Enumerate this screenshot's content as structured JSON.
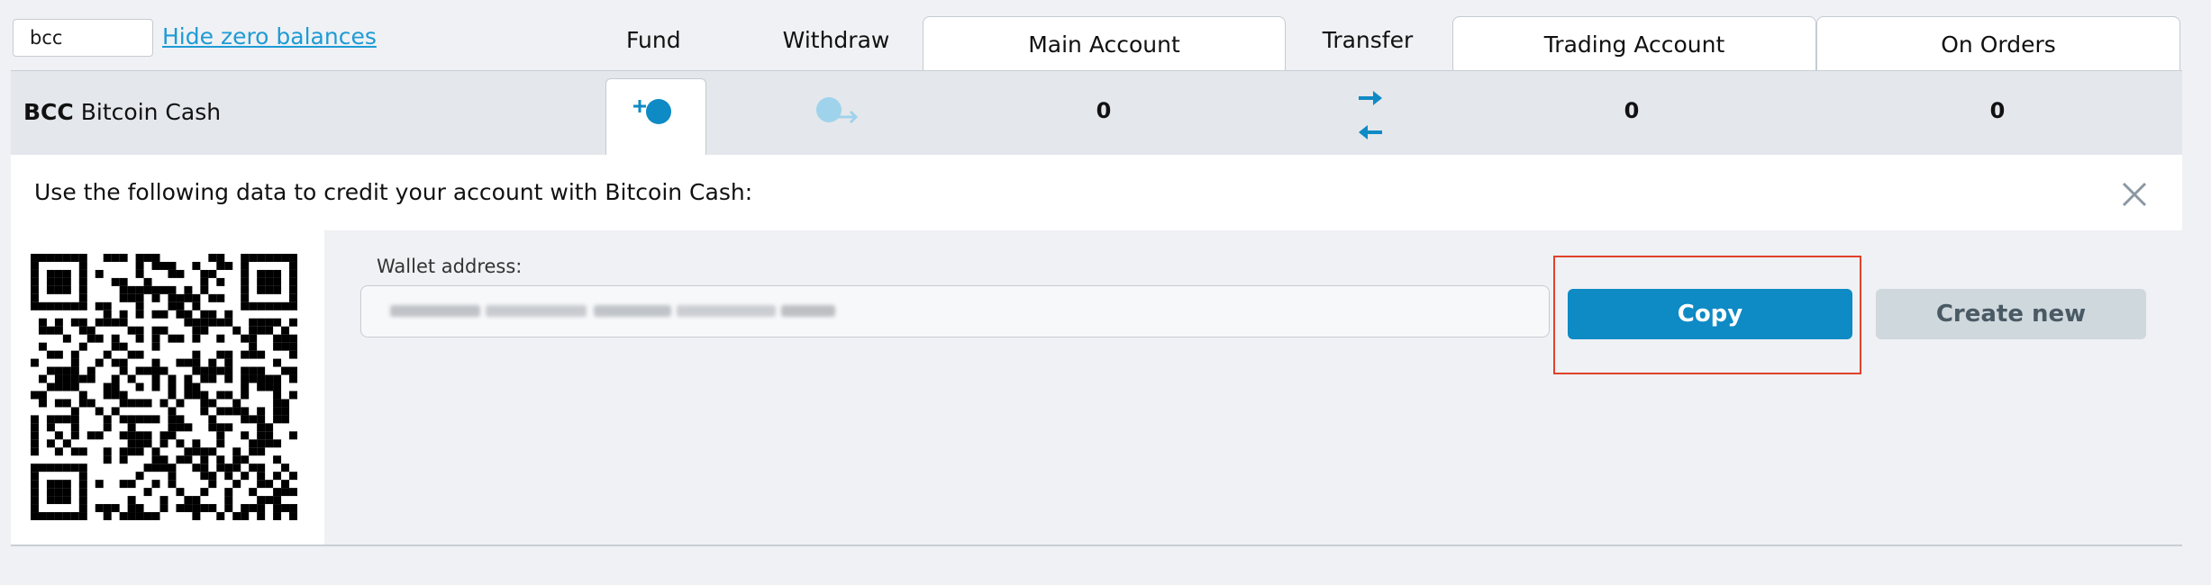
{
  "header": {
    "search_value": "bcc",
    "hide_zero_label": "Hide zero balances",
    "columns": {
      "fund": "Fund",
      "withdraw": "Withdraw",
      "main_account": "Main Account",
      "transfer": "Transfer",
      "trading_account": "Trading Account",
      "on_orders": "On Orders"
    }
  },
  "currency_row": {
    "code": "BCC",
    "name": "Bitcoin Cash",
    "main_balance": "0",
    "trading_balance": "0",
    "orders_balance": "0",
    "fund_icon": "plus-coin-icon",
    "withdraw_icon": "coin-arrow-out-icon",
    "transfer_icon": "double-arrow-icon"
  },
  "deposit_panel": {
    "title": "Use the following data to credit your account with Bitcoin Cash:",
    "close_icon": "close-icon",
    "qr_icon": "qr-code-icon",
    "wallet_label": "Wallet address:",
    "copy_label": "Copy",
    "create_new_label": "Create new"
  },
  "colors": {
    "accent": "#0e8ac5",
    "link": "#1e9bd4",
    "highlight": "#e0422a",
    "secondary_button": "#cfd8dd"
  }
}
